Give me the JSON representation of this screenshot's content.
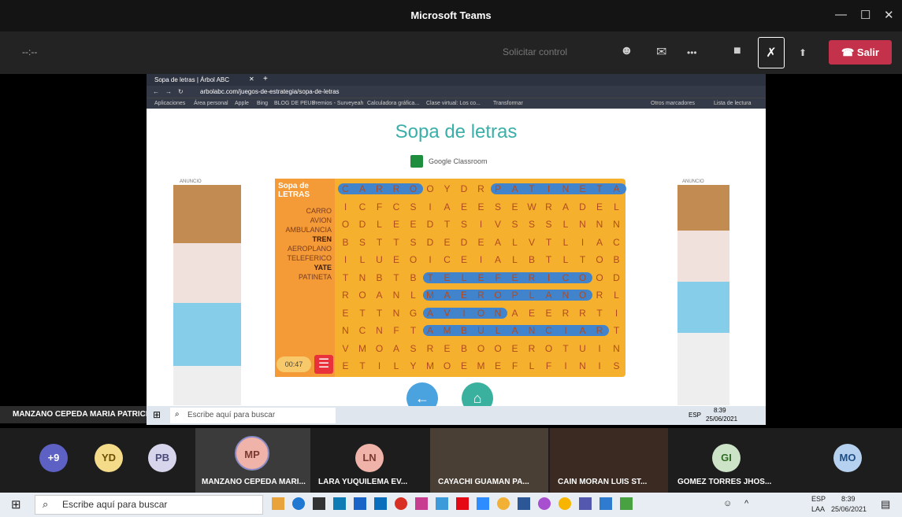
{
  "window": {
    "title": "Microsoft Teams",
    "minimize": "—",
    "maximize": "☐",
    "close": "✕"
  },
  "meeting": {
    "timer": "--:--",
    "request_control": "Solicitar control",
    "more": "•••",
    "leave": "Salir"
  },
  "browser": {
    "tab_title": "Sopa de letras | Árbol ABC",
    "address": "arbolabc.com/juegos-de-estrategia/sopa-de-letras",
    "bookmarks": [
      "Aplicaciones",
      "Área personal",
      "Apple",
      "Bing",
      "BLOG DE PEUS",
      "Premios - Surveyeah",
      "Calculadora gráfica...",
      "Clase virtual: Los co...",
      "Transformar",
      "Otros marcadores",
      "Lista de lectura"
    ]
  },
  "page": {
    "title": "Sopa de letras",
    "classroom": "Google Classroom",
    "ad_label": "ANUNCIO"
  },
  "game": {
    "logo": "Sopa de LETRAS",
    "timer": "00:47",
    "words": [
      "CARRO",
      "AVION",
      "AMBULANCIA",
      "TREN",
      "AEROPLANO",
      "TELEFERICO",
      "YATE",
      "PATINETA"
    ],
    "grid": [
      [
        "C",
        "A",
        "R",
        "R",
        "O",
        "O",
        "Y",
        "D",
        "R",
        "P",
        "A",
        "T",
        "I",
        "N",
        "E",
        "T",
        "A"
      ],
      [
        "I",
        "C",
        "F",
        "C",
        "S",
        "I",
        "A",
        "E",
        "E",
        "S",
        "E",
        "W",
        "R",
        "A",
        "D",
        "E",
        "L"
      ],
      [
        "O",
        "D",
        "L",
        "E",
        "E",
        "D",
        "T",
        "S",
        "I",
        "V",
        "S",
        "S",
        "S",
        "L",
        "N",
        "N",
        "N"
      ],
      [
        "B",
        "S",
        "T",
        "T",
        "S",
        "D",
        "E",
        "D",
        "E",
        "A",
        "L",
        "V",
        "T",
        "L",
        "I",
        "A",
        "C"
      ],
      [
        "I",
        "L",
        "U",
        "E",
        "O",
        "I",
        "C",
        "E",
        "I",
        "A",
        "L",
        "B",
        "T",
        "L",
        "T",
        "O",
        "B"
      ],
      [
        "T",
        "N",
        "B",
        "T",
        "B",
        "T",
        "E",
        "L",
        "E",
        "F",
        "E",
        "R",
        "I",
        "C",
        "O",
        "O",
        "D"
      ],
      [
        "R",
        "O",
        "A",
        "N",
        "L",
        "M",
        "A",
        "E",
        "R",
        "O",
        "P",
        "L",
        "A",
        "N",
        "O",
        "R",
        "L"
      ],
      [
        "E",
        "T",
        "T",
        "N",
        "G",
        "A",
        "V",
        "I",
        "O",
        "N",
        "A",
        "E",
        "E",
        "R",
        "R",
        "T",
        "I"
      ],
      [
        "N",
        "C",
        "N",
        "F",
        "T",
        "A",
        "M",
        "B",
        "U",
        "L",
        "A",
        "N",
        "C",
        "I",
        "A",
        "R",
        "T"
      ],
      [
        "V",
        "M",
        "O",
        "A",
        "S",
        "R",
        "E",
        "B",
        "O",
        "O",
        "E",
        "R",
        "O",
        "T",
        "U",
        "I",
        "N"
      ],
      [
        "E",
        "T",
        "I",
        "L",
        "Y",
        "M",
        "O",
        "E",
        "M",
        "E",
        "F",
        "L",
        "F",
        "I",
        "N",
        "I",
        "S"
      ]
    ]
  },
  "taskbar": {
    "search": "Escribe aquí para buscar",
    "lang": "ESP",
    "lang2": "LAA",
    "time": "8:39",
    "date": "25/06/2021"
  },
  "presenter": {
    "name": "MANZANO CEPEDA MARIA PATRICIA"
  },
  "participants": [
    {
      "initials": "+9",
      "name": ""
    },
    {
      "initials": "YD",
      "name": ""
    },
    {
      "initials": "PB",
      "name": ""
    },
    {
      "initials": "MP",
      "name": "MANZANO CEPEDA MARI..."
    },
    {
      "initials": "LN",
      "name": "LARA YUQUILEMA EV..."
    },
    {
      "initials": "",
      "name": "CAYACHI GUAMAN PA..."
    },
    {
      "initials": "",
      "name": "CAIN MORAN LUIS ST..."
    },
    {
      "initials": "GI",
      "name": "GOMEZ TORRES JHOS..."
    },
    {
      "initials": "MO",
      "name": ""
    }
  ]
}
